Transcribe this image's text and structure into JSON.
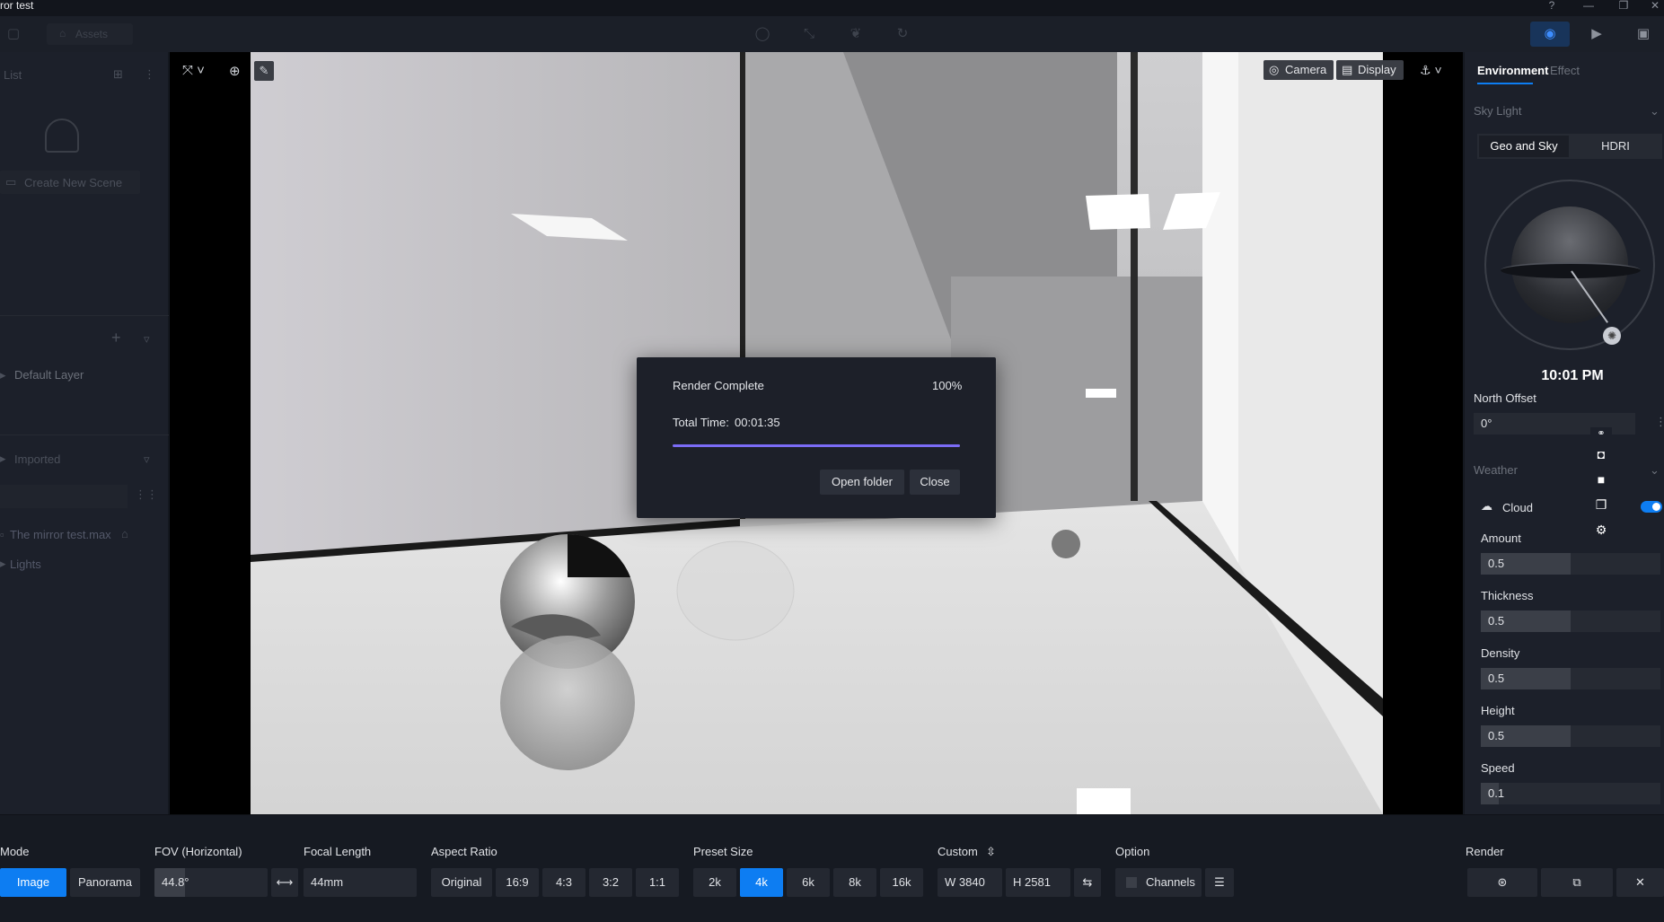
{
  "window": {
    "title": "ror test"
  },
  "toolbar": {
    "assets_label": "Assets"
  },
  "left_panel": {
    "list_label": "List",
    "create_scene_label": "Create New Scene",
    "default_layer_label": "Default Layer",
    "imported_label": "Imported",
    "file_label": "The mirror test.max",
    "lights_label": "Lights"
  },
  "viewport": {
    "camera_label": "Camera",
    "display_label": "Display"
  },
  "modal": {
    "title": "Render Complete",
    "percent_label": "100%",
    "progress": 1.0,
    "time_label": "Total Time:",
    "time_value": "00:01:35",
    "open_folder_label": "Open folder",
    "close_label": "Close"
  },
  "right_panel": {
    "tabs": [
      "Environment",
      "Effect"
    ],
    "sky_light_label": "Sky Light",
    "sky_tabs": [
      "Geo and Sky",
      "HDRI"
    ],
    "time_value": "10:01 PM",
    "north_offset_label": "North Offset",
    "north_offset_value": "0°",
    "weather_label": "Weather",
    "cloud_label": "Cloud",
    "cloud_enabled": true,
    "params": [
      {
        "label": "Amount",
        "value": "0.5",
        "fraction": 0.5
      },
      {
        "label": "Thickness",
        "value": "0.5",
        "fraction": 0.5
      },
      {
        "label": "Density",
        "value": "0.5",
        "fraction": 0.5
      },
      {
        "label": "Height",
        "value": "0.5",
        "fraction": 0.5
      },
      {
        "label": "Speed",
        "value": "0.1",
        "fraction": 0.1
      }
    ]
  },
  "bottom": {
    "mode_label": "Mode",
    "mode_options": [
      "Image",
      "Panorama"
    ],
    "mode_selected": "Image",
    "fov_label": "FOV (Horizontal)",
    "fov_value": "44.8°",
    "focal_label": "Focal Length",
    "focal_value": "44mm",
    "aspect_label": "Aspect Ratio",
    "aspect_options": [
      "Original",
      "16:9",
      "4:3",
      "3:2",
      "1:1"
    ],
    "preset_label": "Preset Size",
    "preset_options": [
      "2k",
      "4k",
      "6k",
      "8k",
      "16k"
    ],
    "preset_selected": "4k",
    "custom_label": "Custom",
    "width_prefix": "W",
    "width_value": "3840",
    "height_prefix": "H",
    "height_value": "2581",
    "option_label": "Option",
    "channels_label": "Channels",
    "render_label": "Render"
  },
  "colors": {
    "accent": "#0d7df2",
    "progress": "#7b6cf6",
    "panel": "#1c202a",
    "background": "#161a22"
  }
}
